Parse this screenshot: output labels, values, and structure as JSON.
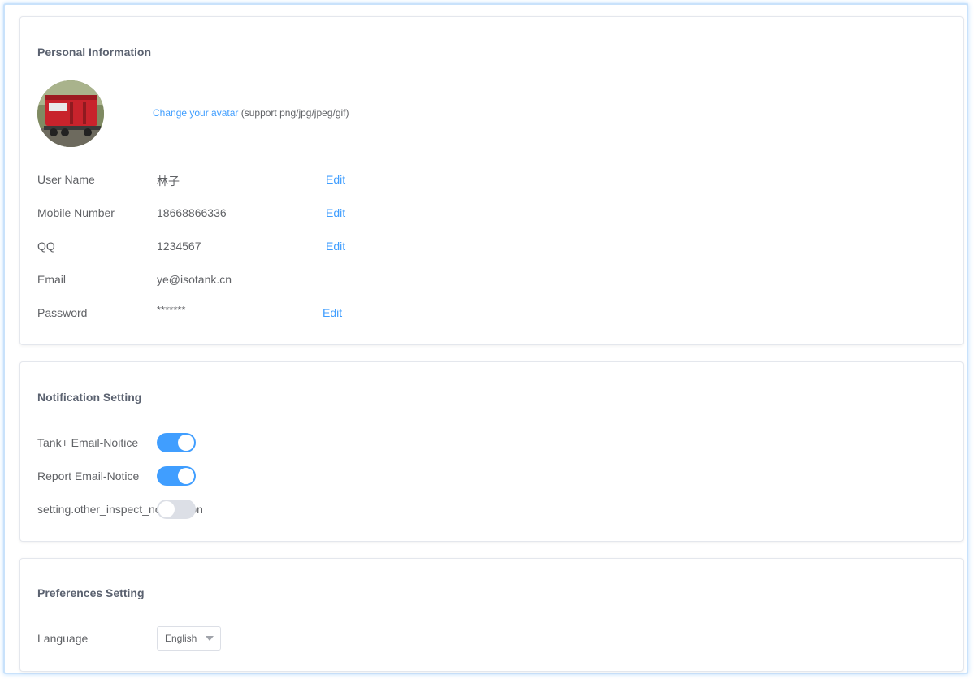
{
  "personal": {
    "title": "Personal Information",
    "avatar_link": "Change your avatar",
    "avatar_hint": " (support png/jpg/jpeg/gif)",
    "fields": [
      {
        "label": "User Name",
        "value": "林子",
        "edit": "Edit"
      },
      {
        "label": "Mobile Number",
        "value": "18668866336",
        "edit": "Edit"
      },
      {
        "label": "QQ",
        "value": "1234567",
        "edit": "Edit"
      },
      {
        "label": "Email",
        "value": "ye@isotank.cn"
      },
      {
        "label": "Password",
        "value": "*******",
        "edit": "Edit"
      }
    ]
  },
  "notification": {
    "title": "Notification Setting",
    "items": [
      {
        "label": "Tank+ Email-Noitice",
        "enabled": true
      },
      {
        "label": "Report Email-Notice",
        "enabled": true
      },
      {
        "label": "setting.other_inspect_notification",
        "enabled": false
      }
    ]
  },
  "preferences": {
    "title": "Preferences Setting",
    "language_label": "Language",
    "language_value": "English"
  },
  "colors": {
    "accent": "#409eff",
    "toggle_off": "#dcdfe6",
    "border": "#e4e7ed"
  }
}
